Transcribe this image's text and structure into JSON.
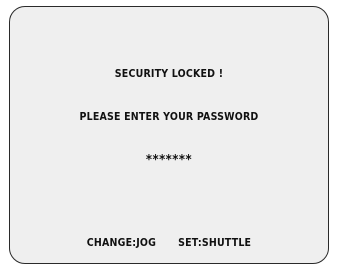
{
  "screen": {
    "title": "SECURITY LOCKED !",
    "prompt": "PLEASE ENTER YOUR PASSWORD",
    "password_mask": "*******",
    "footer": {
      "change_hint": "CHANGE:JOG",
      "set_hint": "SET:SHUTTLE"
    }
  },
  "colors": {
    "background": "#efefef",
    "text": "#111111",
    "border": "#2a2a2a"
  }
}
